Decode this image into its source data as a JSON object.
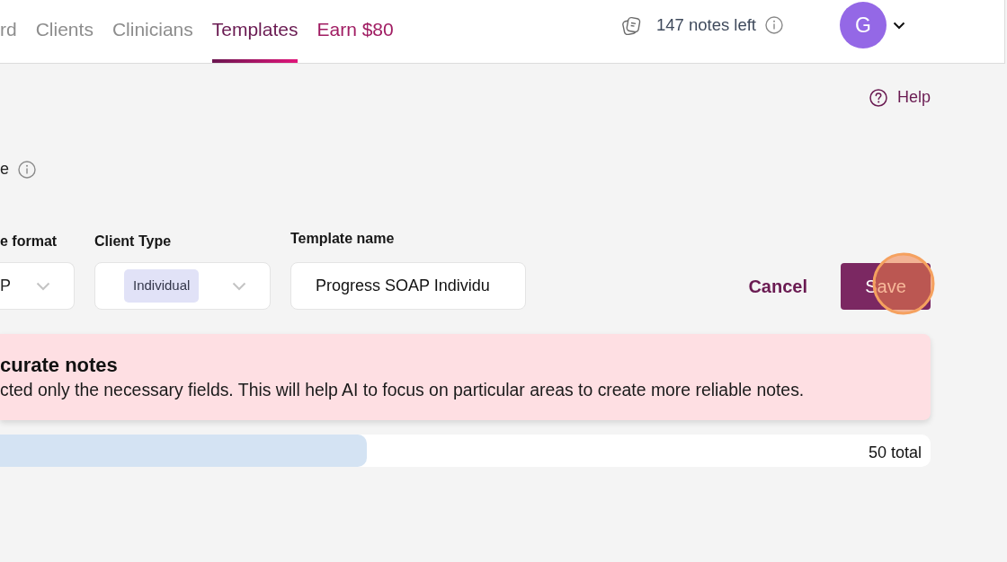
{
  "nav": {
    "tabs": [
      {
        "label": "rd",
        "kind": "link",
        "selected": false
      },
      {
        "label": "Clients",
        "kind": "link",
        "selected": false
      },
      {
        "label": "Clinicians",
        "kind": "link",
        "selected": false
      },
      {
        "label": "Templates",
        "kind": "link",
        "selected": true
      },
      {
        "label": "Earn $80",
        "kind": "promo",
        "selected": false
      }
    ],
    "notes_left": "147 notes left",
    "avatar_initial": "G"
  },
  "help": {
    "label": "Help"
  },
  "section": {
    "label": "e"
  },
  "fields": [
    {
      "kind": "select",
      "label": "e format",
      "value": "P"
    },
    {
      "kind": "tag-select",
      "label": "Client Type",
      "tag": "Individual"
    },
    {
      "kind": "text",
      "label": "Template name",
      "value": "Progress SOAP Individu"
    }
  ],
  "actions": [
    {
      "kind": "link",
      "label": "Cancel",
      "highlighted": false
    },
    {
      "kind": "primary",
      "label": "Save",
      "highlighted": true
    }
  ],
  "alert": {
    "title": "curate notes",
    "text": "cted only the necessary fields. This will help AI to focus on particular areas to create more reliable notes."
  },
  "usage": {
    "level": 0.394,
    "total": "50 total"
  }
}
